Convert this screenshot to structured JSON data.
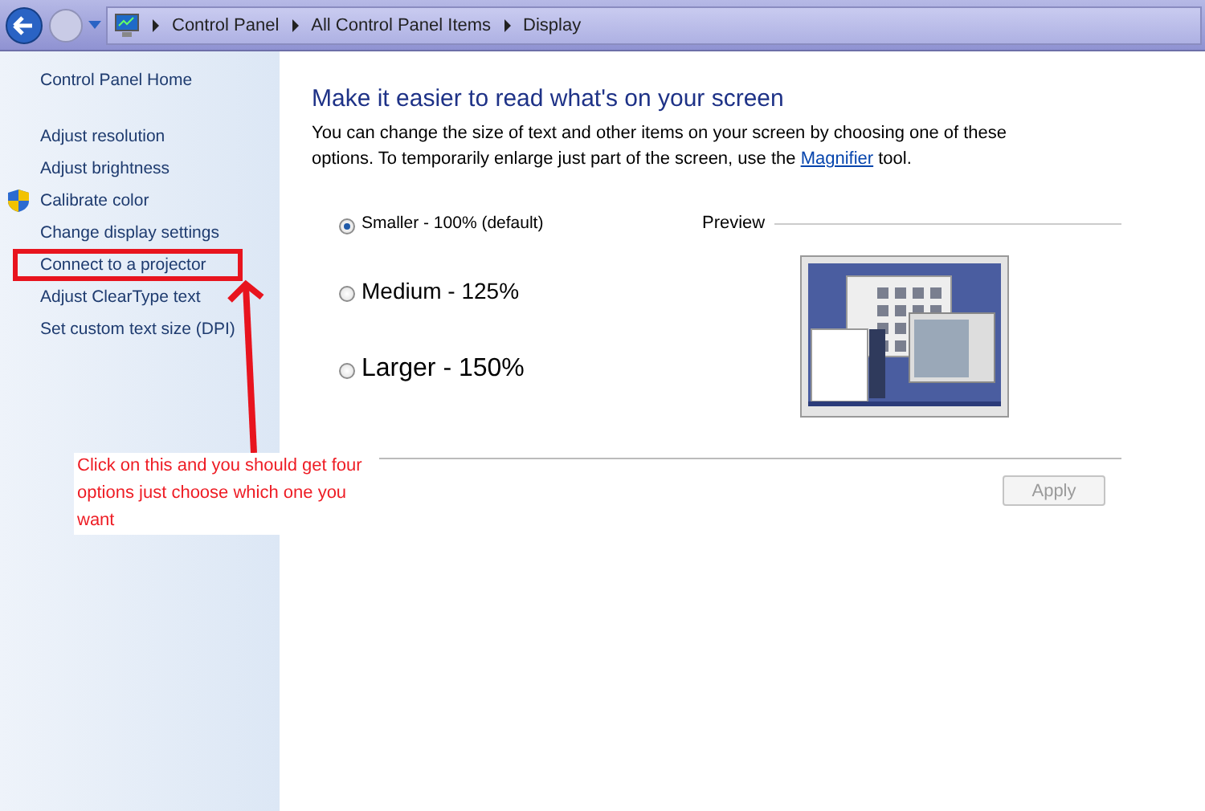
{
  "address_bar": {
    "breadcrumbs": [
      "Control Panel",
      "All Control Panel Items",
      "Display"
    ]
  },
  "sidebar": {
    "home": "Control Panel Home",
    "items": [
      {
        "label": "Adjust resolution",
        "shield": false,
        "highlighted": false
      },
      {
        "label": "Adjust brightness",
        "shield": false,
        "highlighted": false
      },
      {
        "label": "Calibrate color",
        "shield": true,
        "highlighted": false
      },
      {
        "label": "Change display settings",
        "shield": false,
        "highlighted": false
      },
      {
        "label": "Connect to a projector",
        "shield": false,
        "highlighted": true
      },
      {
        "label": "Adjust ClearType text",
        "shield": false,
        "highlighted": false
      },
      {
        "label": "Set custom text size (DPI)",
        "shield": false,
        "highlighted": false
      }
    ]
  },
  "main": {
    "heading": "Make it easier to read what's on your screen",
    "intro_before": "You can change the size of text and other items on your screen by choosing one of these options. To temporarily enlarge just part of the screen, use the",
    "intro_link": "Magnifier",
    "intro_after": "tool.",
    "options": [
      {
        "label": "Smaller - 100% (default)",
        "kind": "small",
        "selected": true
      },
      {
        "label": "Medium - 125%",
        "kind": "medium",
        "selected": false
      },
      {
        "label": "Larger - 150%",
        "kind": "large",
        "selected": false
      }
    ],
    "preview_label": "Preview",
    "apply_button": {
      "label": "Apply",
      "disabled": true
    }
  },
  "annotation": {
    "note": "Click on this and you should get four options just choose which one you want"
  }
}
